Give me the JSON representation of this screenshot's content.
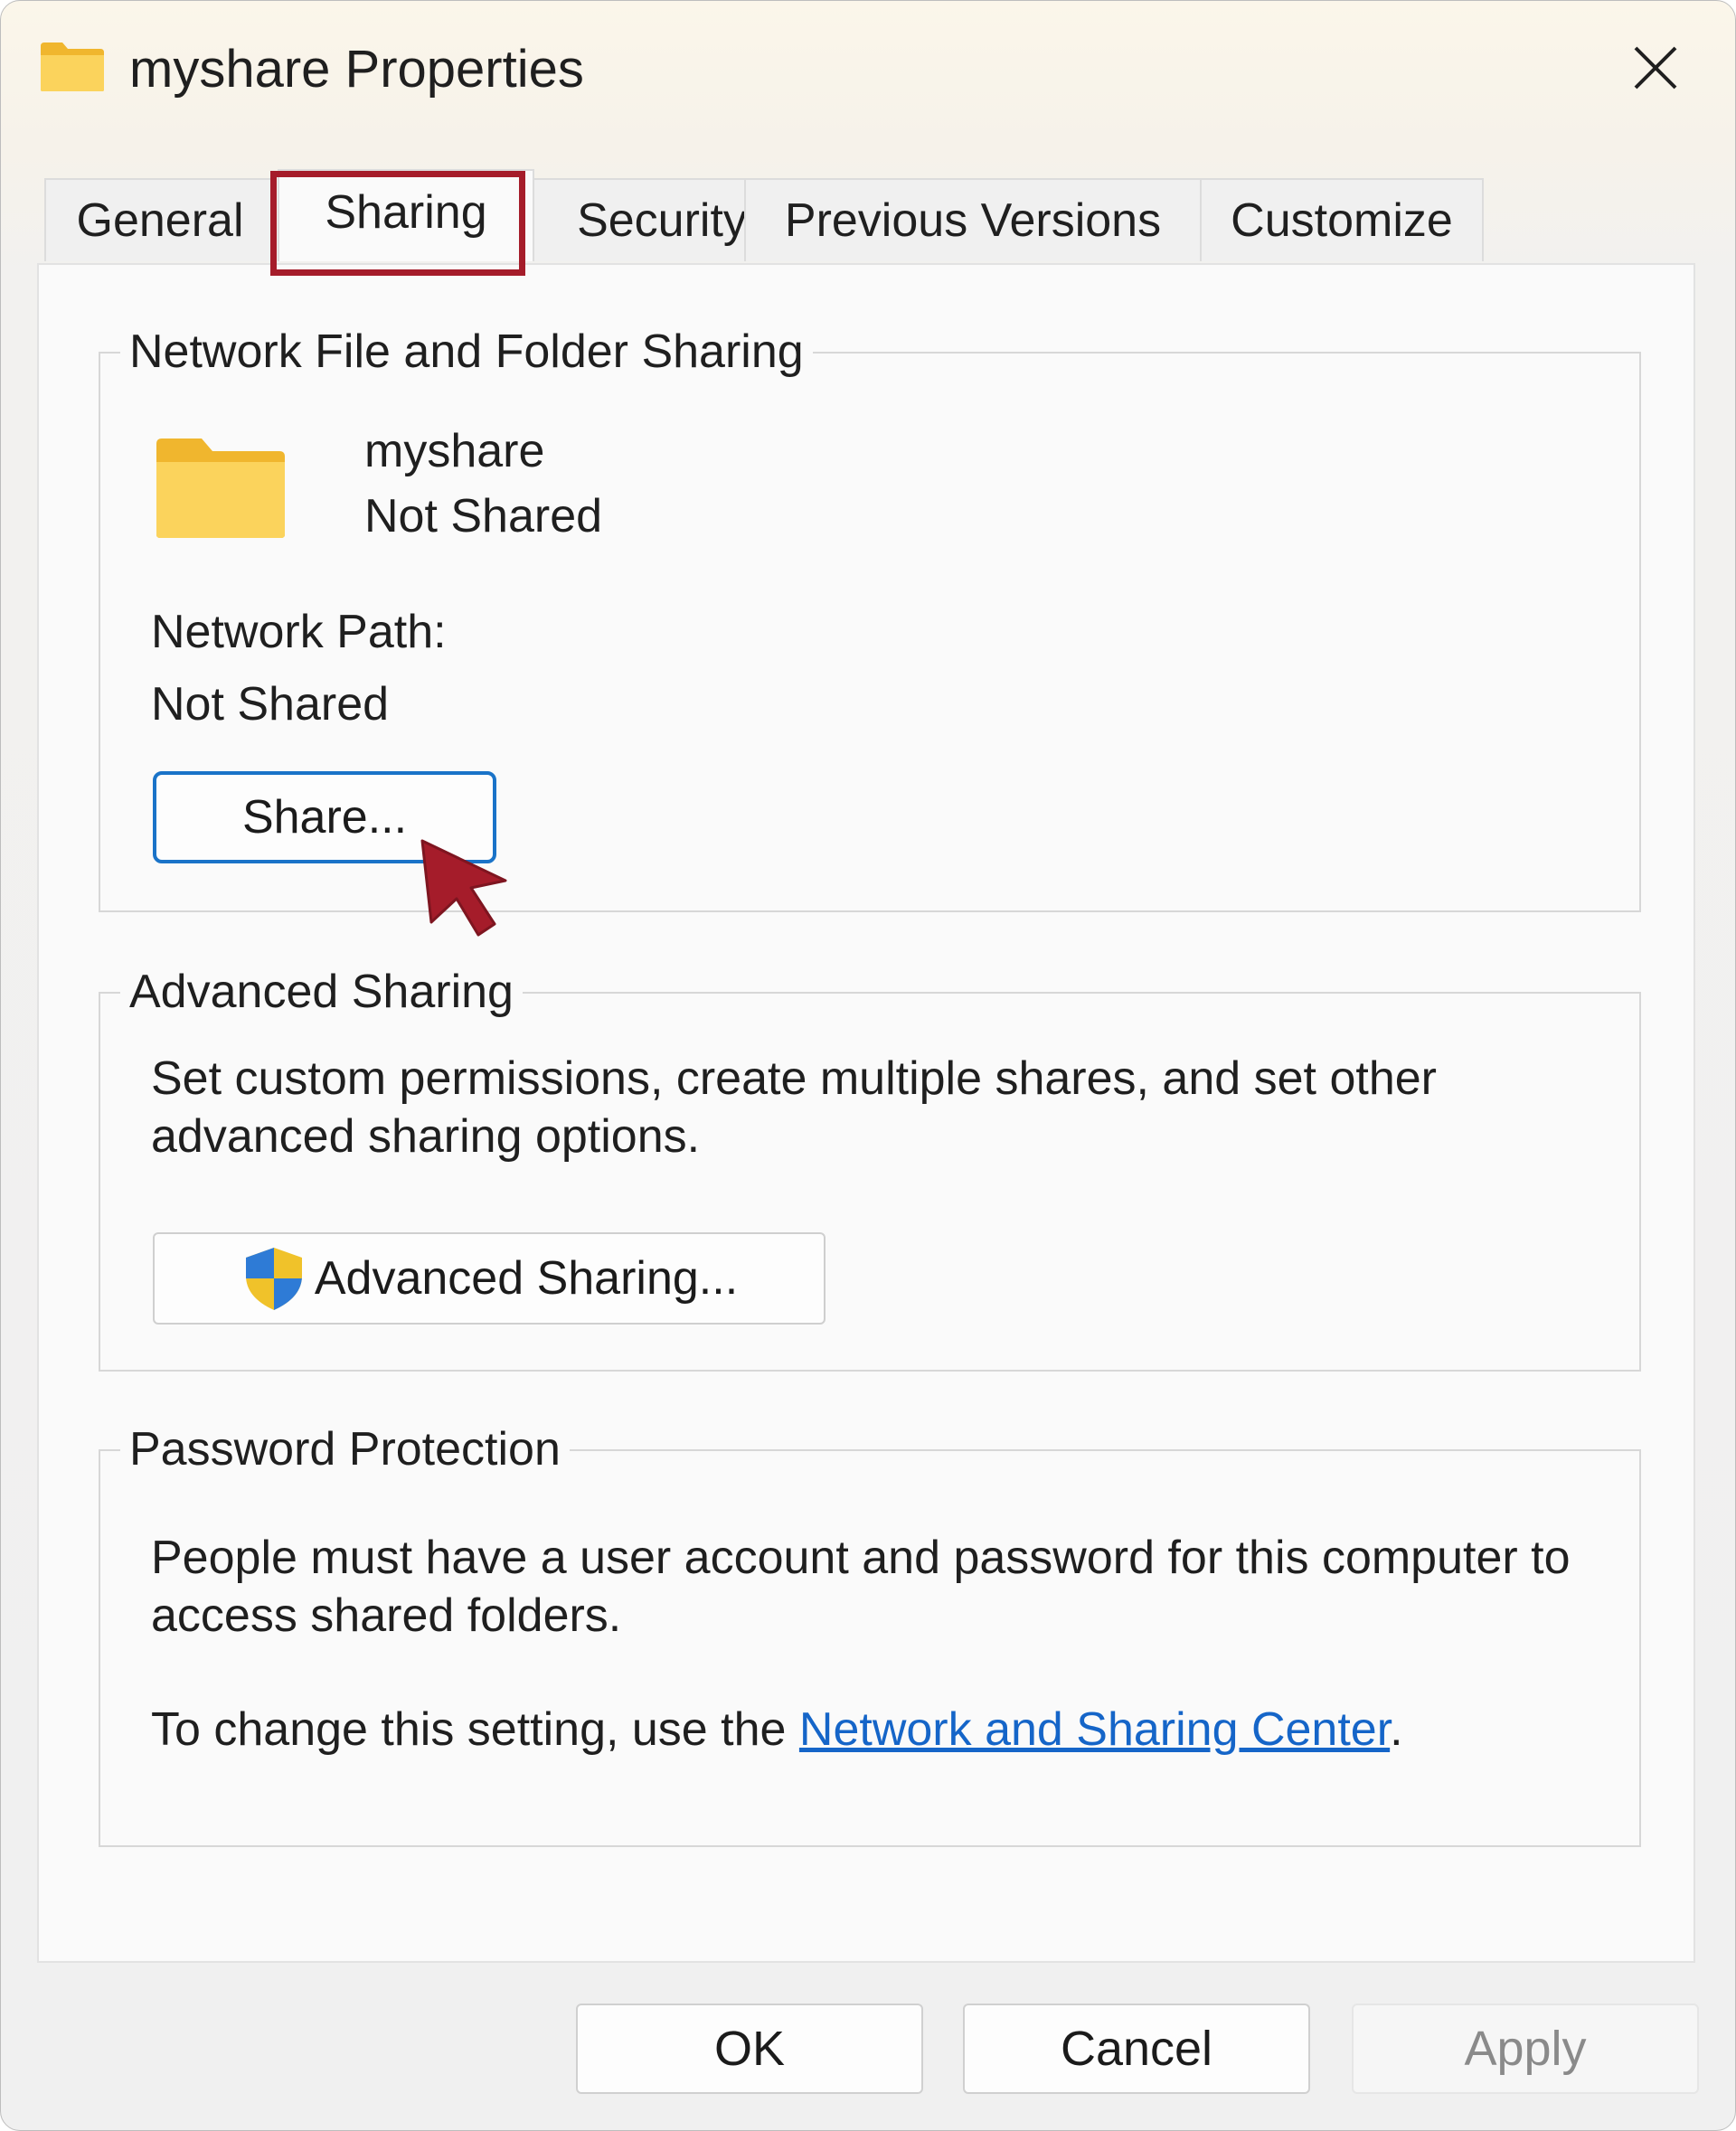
{
  "window": {
    "title": "myshare Properties",
    "title_icon": "folder-icon",
    "close_icon": "close-icon"
  },
  "tabs": [
    {
      "label": "General"
    },
    {
      "label": "Sharing",
      "active": true,
      "highlighted": true
    },
    {
      "label": "Security"
    },
    {
      "label": "Previous Versions"
    },
    {
      "label": "Customize"
    }
  ],
  "network_sharing": {
    "legend": "Network File and Folder Sharing",
    "folder_icon": "folder-icon",
    "folder_name": "myshare",
    "status": "Not Shared",
    "path_label": "Network Path:",
    "path_value": "Not Shared",
    "share_button": "Share..."
  },
  "advanced_sharing": {
    "legend": "Advanced Sharing",
    "description_line1": "Set custom permissions, create multiple shares, and set other",
    "description_line2": "advanced sharing options.",
    "button_icon": "uac-shield-icon",
    "button": "Advanced Sharing..."
  },
  "password_protection": {
    "legend": "Password Protection",
    "description_line1": "People must have a user account and password for this computer to",
    "description_line2": "access shared folders.",
    "setting_prefix": "To change this setting, use the ",
    "link_text": "Network and Sharing Center",
    "setting_suffix": "."
  },
  "footer": {
    "ok": "OK",
    "cancel": "Cancel",
    "apply": "Apply"
  },
  "annotations": {
    "cursor_icon": "pointer-arrow-icon",
    "highlight_color": "#a51c2a"
  },
  "colors": {
    "folder": "#f6c74a",
    "link": "#1565c8",
    "focus": "#1a73c8"
  }
}
